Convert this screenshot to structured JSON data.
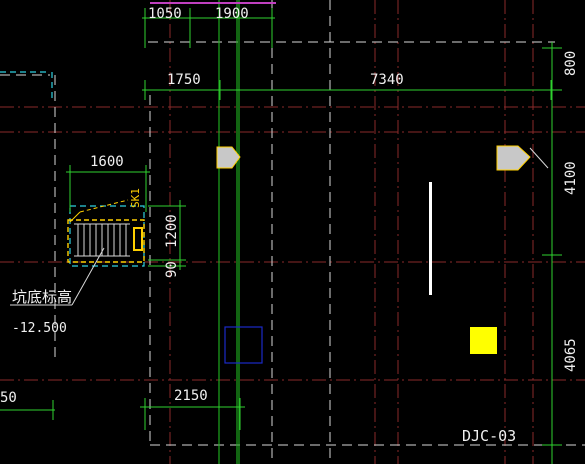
{
  "colors": {
    "background": "#000000",
    "dim": "#f0f0f0",
    "dim_line": "#2fd22f",
    "axis_red": "#8a2a2a",
    "cyan": "#2fd0e0",
    "yellow": "#ffd000",
    "yellow_fill": "#ffff00",
    "gray_fill": "#c8c8c8",
    "blue": "#1a2ac8",
    "white": "#ffffff",
    "magenta": "#c040c0",
    "green_grid": "#1fa81f"
  },
  "dimensions": {
    "top_a": "1050",
    "top_b": "1900",
    "row2_a": "1750",
    "row2_b": "7340",
    "pit_width": "1600",
    "pit_height": "1200",
    "pit_offset": "90",
    "bottom_left": "2150",
    "right_top": "800",
    "right_mid": "4100",
    "right_bottom": "4065",
    "left_partial": "50"
  },
  "labels": {
    "pit_code": "SK1",
    "pit_elevation_label": "坑底标高",
    "pit_elevation_value": "-12.500",
    "foundation_code": "DJC-03"
  }
}
